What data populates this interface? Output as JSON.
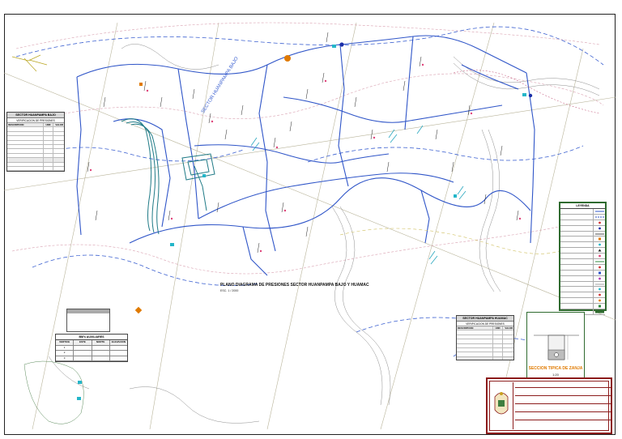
{
  "plan": {
    "title": "PLANO DIAGRAMA DE PRESIONES SECTOR HUANPAMPA BAJO Y HUAMAC",
    "scale": "ESC. 1 / 2000",
    "sector_label": "SECTOR HUANPAMPA BAJO"
  },
  "tables": {
    "left": {
      "title": "SECTOR HUANPAMPA BAJO",
      "subtitle": "VERIFICACION DE PRESIONES",
      "rows": [
        {
          "label": "DESCRIPCION",
          "unit": "UND",
          "value": "VALOR",
          "group": true
        },
        {
          "label": "",
          "unit": "",
          "value": ""
        },
        {
          "label": "",
          "unit": "",
          "value": ""
        },
        {
          "label": "",
          "unit": "",
          "value": ""
        },
        {
          "label": "",
          "unit": "",
          "value": ""
        },
        {
          "label": "",
          "unit": "",
          "value": ""
        },
        {
          "label": "",
          "unit": "",
          "value": ""
        },
        {
          "label": "",
          "unit": "",
          "value": ""
        },
        {
          "label": "",
          "unit": "",
          "value": "",
          "group": true
        },
        {
          "label": "",
          "unit": "",
          "value": ""
        },
        {
          "label": "",
          "unit": "",
          "value": ""
        },
        {
          "label": "",
          "unit": "",
          "value": ""
        },
        {
          "label": "",
          "unit": "",
          "value": "",
          "group": true
        },
        {
          "label": "",
          "unit": "",
          "value": ""
        },
        {
          "label": "",
          "unit": "",
          "value": ""
        },
        {
          "label": "",
          "unit": "",
          "value": ""
        }
      ]
    },
    "right": {
      "title": "SECTOR HUANPAMPA HUAMAC",
      "subtitle": "VERIFICACION DE PRESIONES",
      "rows": [
        {
          "label": "DESCRIPCION",
          "unit": "UND",
          "value": "VALOR",
          "group": true
        },
        {
          "label": "",
          "unit": "",
          "value": ""
        },
        {
          "label": "",
          "unit": "",
          "value": ""
        },
        {
          "label": "",
          "unit": "",
          "value": ""
        },
        {
          "label": "",
          "unit": "",
          "value": ""
        },
        {
          "label": "",
          "unit": "",
          "value": ""
        },
        {
          "label": "",
          "unit": "",
          "value": ""
        },
        {
          "label": "",
          "unit": "",
          "value": "",
          "group": true
        },
        {
          "label": "",
          "unit": "",
          "value": ""
        },
        {
          "label": "",
          "unit": "",
          "value": ""
        },
        {
          "label": "",
          "unit": "",
          "value": ""
        }
      ]
    }
  },
  "coordinates": {
    "title": "BM's AUXILIARES",
    "headers": [
      "VERTICE",
      "ESTE",
      "NORTE",
      "ELEVACION"
    ],
    "rows": [
      [
        "1",
        "",
        "",
        ""
      ],
      [
        "2",
        "",
        "",
        ""
      ],
      [
        "3",
        "",
        "",
        ""
      ]
    ]
  },
  "legend": {
    "title": "LEYENDA",
    "items": [
      {
        "label": "",
        "symbol": "line-blue"
      },
      {
        "label": "",
        "symbol": "line-blue-dash"
      },
      {
        "label": "",
        "symbol": "dot-red"
      },
      {
        "label": "",
        "symbol": "dot-blue"
      },
      {
        "label": "",
        "symbol": "line-black"
      },
      {
        "label": "",
        "symbol": "square-orange"
      },
      {
        "label": "",
        "symbol": "dot-cyan"
      },
      {
        "label": "",
        "symbol": "triangle"
      },
      {
        "label": "",
        "symbol": "dot-pink"
      },
      {
        "label": "",
        "symbol": "line-green"
      },
      {
        "label": "",
        "symbol": "dot-red"
      },
      {
        "label": "",
        "symbol": "square-blue"
      },
      {
        "label": "",
        "symbol": "dot-magenta"
      },
      {
        "label": "",
        "symbol": "line-gray"
      },
      {
        "label": "",
        "symbol": "dot-cyan"
      },
      {
        "label": "",
        "symbol": "dot-red"
      },
      {
        "label": "",
        "symbol": "dot-orange"
      },
      {
        "label": "",
        "symbol": "square-green"
      },
      {
        "label": "",
        "symbol": "bar-green"
      }
    ]
  },
  "trench_section": {
    "header": "",
    "name": "SECCION TIPICA DE ZANJA",
    "scale": "1:20"
  },
  "title_block": {
    "project_line": "",
    "sheet_line": ""
  },
  "colors": {
    "pipe": "#2f55c8",
    "contour_dash": "#3a5fd0",
    "grid_road": "#9a9a6a",
    "frame_red": "#8c1c1c",
    "legend_green": "#2f6b2f",
    "accent_orange": "#e07a00"
  }
}
